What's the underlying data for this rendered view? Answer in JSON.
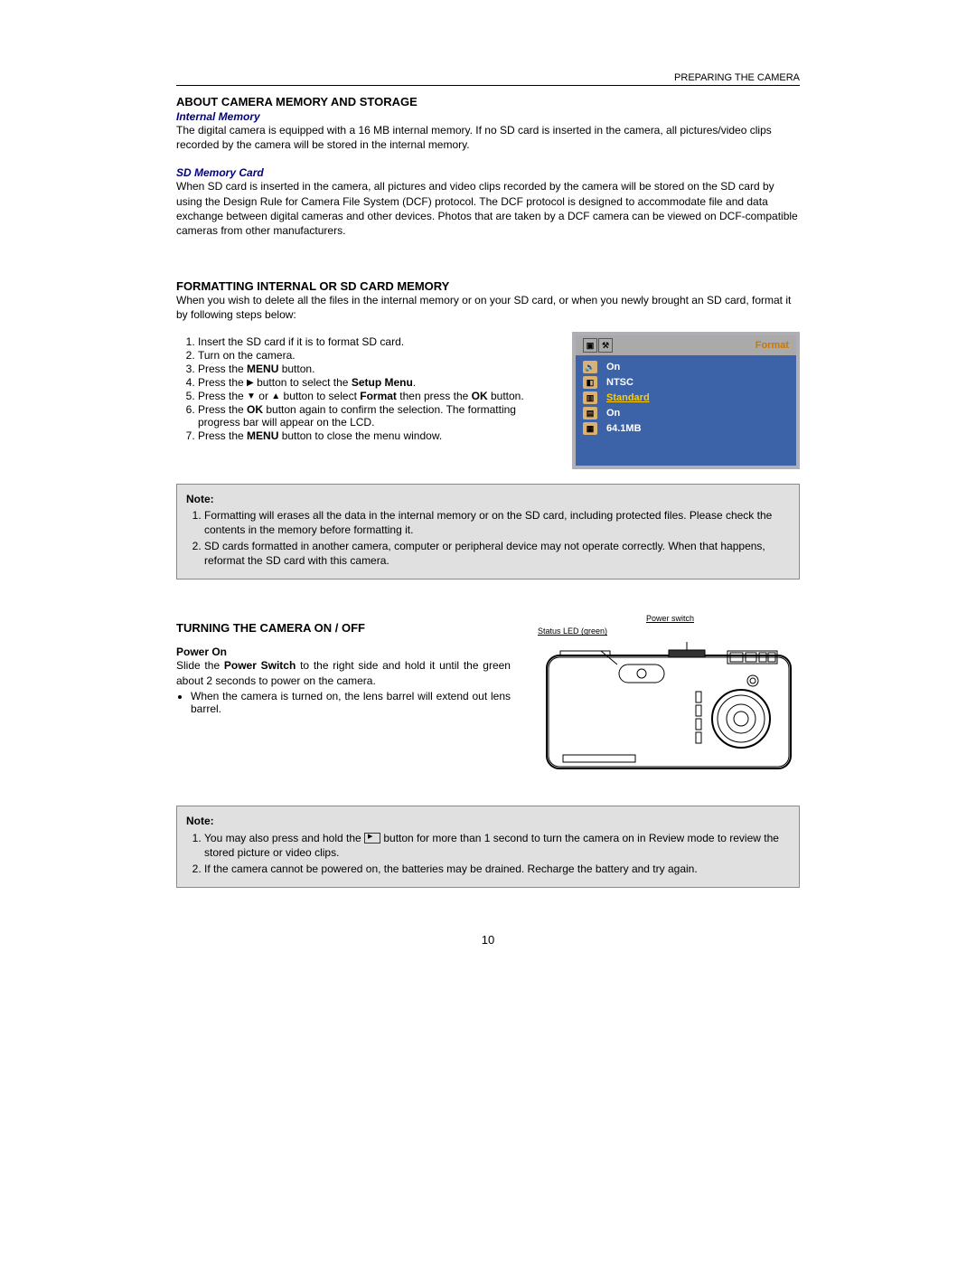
{
  "header": {
    "section": "PREPARING THE CAMERA"
  },
  "s1": {
    "title": "ABOUT CAMERA MEMORY AND STORAGE",
    "sub1": "Internal Memory",
    "p1": "The digital camera is equipped with a 16 MB internal memory. If no SD card is inserted in the camera, all pictures/video clips recorded by the camera will be stored in the internal memory.",
    "sub2": "SD Memory Card",
    "p2": "When SD card is inserted in the camera, all pictures and video clips recorded by the camera will be stored on the SD card by using the Design Rule for Camera File System (DCF) protocol. The DCF protocol is designed to accommodate file and data exchange between digital cameras and other devices. Photos that are taken by a DCF camera can be viewed on DCF-compatible cameras from other manufacturers."
  },
  "s2": {
    "title": "FORMATTING INTERNAL OR SD CARD MEMORY",
    "intro": "When you wish to delete all the files in the internal memory or on your SD card, or when you newly brought an SD card, format it by following steps below:",
    "steps": {
      "i1": "Insert the SD card if it is to format SD card.",
      "i2": "Turn on the camera.",
      "i3a": "Press the ",
      "i3b": " button.",
      "menu": "MENU",
      "i4a": "Press the ",
      "i4b": " button to select the ",
      "i4c": ".",
      "setup_menu": "Setup Menu",
      "i5a": "Press the ",
      "i5b": " or ",
      "i5c": " button to select ",
      "i5d": " then press the ",
      "i5e": " button.",
      "format": "Format",
      "ok": "OK",
      "i6a": "Press the ",
      "i6b": " button again to confirm the selection. The formatting progress bar will appear on the LCD.",
      "i7a": "Press the ",
      "i7b": " button to close the menu window."
    },
    "lcd": {
      "title": "Format",
      "r1": "On",
      "r2": "NTSC",
      "r3": "Standard",
      "r4": "On",
      "r5": "64.1MB"
    }
  },
  "note1": {
    "label": "Note:",
    "i1": "Formatting will erases all the data in the internal memory or on the SD card, including protected files. Please check the contents in the memory before formatting it.",
    "i2": "SD cards formatted in another camera, computer or peripheral device may not operate correctly. When that happens, reformat the SD card with this camera."
  },
  "s3": {
    "title": "TURNING THE CAMERA ON / OFF",
    "sub": "Power On",
    "p1a": "Slide the ",
    "p1b": "Power Switch",
    "p1c": " to the right side and hold it until the green about 2 seconds to power on the camera.",
    "bullet": "When the camera is turned on, the lens barrel will extend out lens barrel.",
    "diagram": {
      "power_switch": "Power switch",
      "status_led": "Status LED (green)"
    }
  },
  "note2": {
    "label": "Note:",
    "i1a": "You may also press and hold the ",
    "i1b": " button for more than 1 second to turn the camera on in Review mode to review the stored picture or video clips.",
    "i2": "If the camera cannot be powered on, the batteries may be drained. Recharge the battery and try again."
  },
  "page_number": "10"
}
